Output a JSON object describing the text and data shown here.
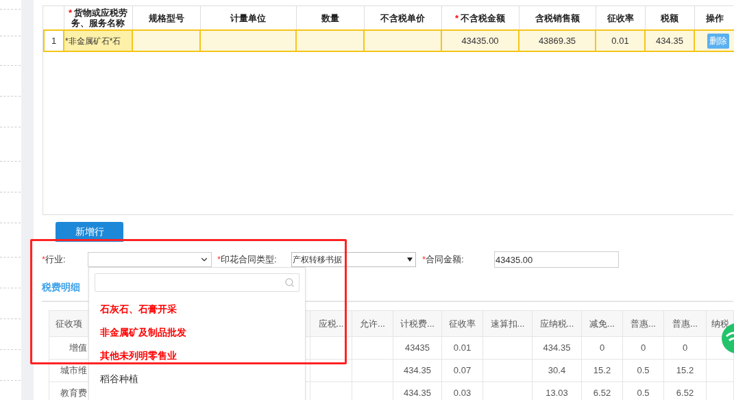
{
  "goods_table": {
    "columns": [
      {},
      {
        "mark": "*",
        "label": "货物或应税劳务、服务名称"
      },
      {
        "label": "规格型号"
      },
      {
        "label": "计量单位"
      },
      {
        "label": "数量"
      },
      {
        "label": "不含税单价"
      },
      {
        "mark": "*",
        "label": "不含税金额"
      },
      {
        "label": "含税销售额"
      },
      {
        "label": "征收率"
      },
      {
        "label": "税额"
      },
      {
        "label": "操作"
      }
    ],
    "rows": [
      {
        "index": "1",
        "name": "*非金属矿石*石",
        "spec": "",
        "unit": "",
        "qty": "",
        "price": "",
        "amount": "43435.00",
        "gross": "43869.35",
        "rate": "0.01",
        "tax": "434.35",
        "action": "删除"
      }
    ]
  },
  "add_row_button": "新增行",
  "form": [
    {
      "mark": "*",
      "label": "行业:",
      "kind": "dropdown"
    },
    {
      "mark": "*",
      "label": "印花合同类型:",
      "kind": "select",
      "value": "产权转移书据"
    },
    {
      "mark": "*",
      "label": "合同金额:",
      "kind": "input",
      "value": "43435.00"
    }
  ],
  "section_tab": "税费明细",
  "industry_dropdown": {
    "items": [
      {
        "label": "石灰石、石膏开采",
        "highlighted": true
      },
      {
        "label": "非金属矿及制品批发",
        "highlighted": true
      },
      {
        "label": "其他未列明零售业",
        "highlighted": true
      },
      {
        "label": "稻谷种植",
        "highlighted": false
      }
    ]
  },
  "tax_table": {
    "columns": [
      "征收项",
      "",
      "应税...",
      "允许...",
      "计税费...",
      "征收率",
      "速算扣...",
      "应纳税...",
      "减免...",
      "普惠...",
      "普惠...",
      "纳税"
    ],
    "rows": [
      [
        "增值",
        "",
        "",
        "",
        "43435",
        "0.01",
        "",
        "434.35",
        "0",
        "0",
        "0",
        ""
      ],
      [
        "城市维",
        "",
        "",
        "",
        "434.35",
        "0.07",
        "",
        "30.4",
        "15.2",
        "0.5",
        "15.2",
        ""
      ],
      [
        "教育费",
        "",
        "",
        "",
        "434.35",
        "0.03",
        "",
        "13.03",
        "6.52",
        "0.5",
        "6.52",
        ""
      ]
    ]
  }
}
